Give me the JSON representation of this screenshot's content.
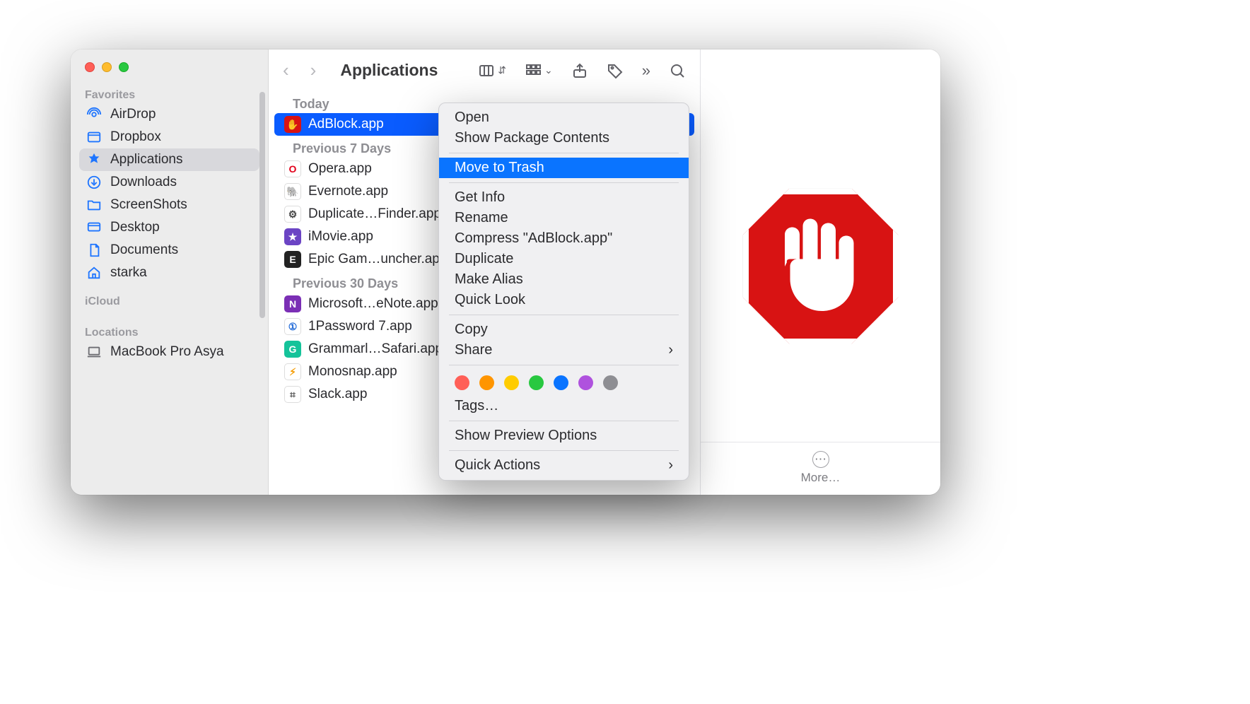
{
  "toolbar": {
    "title": "Applications"
  },
  "sidebar": {
    "groups": {
      "favorites": "Favorites",
      "icloud": "iCloud",
      "locations": "Locations"
    },
    "items": [
      {
        "label": "AirDrop"
      },
      {
        "label": "Dropbox"
      },
      {
        "label": "Applications"
      },
      {
        "label": "Downloads"
      },
      {
        "label": "ScreenShots"
      },
      {
        "label": "Desktop"
      },
      {
        "label": "Documents"
      },
      {
        "label": "starka"
      }
    ],
    "location": "MacBook Pro Asya"
  },
  "list": {
    "groups": {
      "today": "Today",
      "prev7": "Previous 7 Days",
      "prev30": "Previous 30 Days"
    },
    "today": [
      {
        "name": "AdBlock.app",
        "icon_bg": "#d81313",
        "icon_glyph": "✋"
      }
    ],
    "prev7": [
      {
        "name": "Opera.app",
        "icon_bg": "#ffffff",
        "icon_text": "O",
        "icon_color": "#e2001a"
      },
      {
        "name": "Evernote.app",
        "icon_bg": "#ffffff",
        "icon_text": "🐘",
        "icon_color": "#2dbe60"
      },
      {
        "name": "Duplicate…Finder.app",
        "icon_bg": "#ffffff",
        "icon_text": "⚙︎",
        "icon_color": "#444"
      },
      {
        "name": "iMovie.app",
        "icon_bg": "#6b44c4",
        "icon_text": "★",
        "icon_color": "#fff"
      },
      {
        "name": "Epic Gam…uncher.app",
        "icon_bg": "#222222",
        "icon_text": "E",
        "icon_color": "#fff"
      }
    ],
    "prev30": [
      {
        "name": "Microsoft…eNote.app",
        "icon_bg": "#7b2fb5",
        "icon_text": "N",
        "icon_color": "#fff"
      },
      {
        "name": "1Password 7.app",
        "icon_bg": "#ffffff",
        "icon_text": "①",
        "icon_color": "#1a65d6"
      },
      {
        "name": "Grammarl…Safari.app",
        "icon_bg": "#15c39a",
        "icon_text": "G",
        "icon_color": "#fff"
      },
      {
        "name": "Monosnap.app",
        "icon_bg": "#ffffff",
        "icon_text": "⚡︎",
        "icon_color": "#f59b00"
      },
      {
        "name": "Slack.app",
        "icon_bg": "#ffffff",
        "icon_text": "⌗",
        "icon_color": "#555"
      }
    ]
  },
  "context_menu": {
    "open": "Open",
    "pkg": "Show Package Contents",
    "trash": "Move to Trash",
    "info": "Get Info",
    "rename": "Rename",
    "compress": "Compress \"AdBlock.app\"",
    "dup": "Duplicate",
    "alias": "Make Alias",
    "ql": "Quick Look",
    "copy": "Copy",
    "share": "Share",
    "tags": "Tags…",
    "preview_opts": "Show Preview Options",
    "quick_actions": "Quick Actions",
    "tag_colors": [
      "#ff5f57",
      "#ff9500",
      "#ffcc00",
      "#28c840",
      "#0a74ff",
      "#af52de",
      "#8e8e93"
    ]
  },
  "preview": {
    "more": "More…"
  }
}
